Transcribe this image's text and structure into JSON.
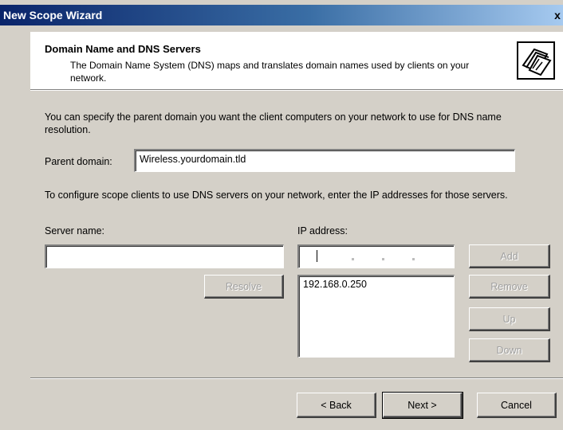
{
  "window": {
    "title": "New Scope Wizard",
    "close_glyph": "x"
  },
  "header": {
    "title": "Domain Name and DNS Servers",
    "subtitle": "The Domain Name System (DNS) maps and translates domain names used by clients on your network.",
    "icon": "folder-stack-icon"
  },
  "body": {
    "intro": "You can specify the parent domain you want the client computers on your network to use for DNS name resolution.",
    "parent_domain_label": "Parent domain:",
    "parent_domain_value": "Wireless.yourdomain.tld",
    "servers_instruction": "To configure scope clients to use DNS servers on your network, enter the IP addresses for those servers.",
    "server_name_label": "Server name:",
    "server_name_value": "",
    "ip_address_label": "IP address:",
    "ip_address_value": "",
    "ip_list": [
      "192.168.0.250"
    ]
  },
  "buttons": {
    "resolve": "Resolve",
    "add": "Add",
    "remove": "Remove",
    "up": "Up",
    "down": "Down",
    "back": "< Back",
    "next": "Next >",
    "cancel": "Cancel"
  },
  "colors": {
    "titlebar_start": "#0a246a",
    "titlebar_end": "#a6caf0",
    "dialog_face": "#d4d0c8"
  }
}
